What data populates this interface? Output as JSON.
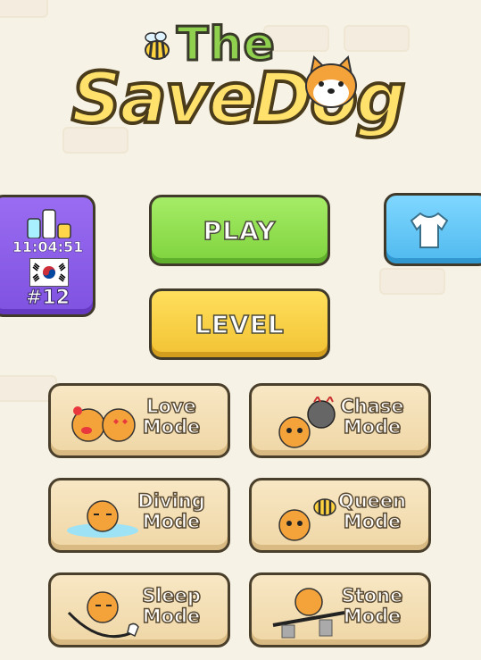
{
  "title": {
    "line1": "The",
    "line2": "SaveDog"
  },
  "buttons": {
    "play": "PLAY",
    "level": "LEVEL"
  },
  "ranking": {
    "time": "11:04:51",
    "rank": "#12",
    "flag": "south-korea-flag"
  },
  "shop": {
    "icon": "shirt-icon"
  },
  "modes": [
    {
      "line1": "Love",
      "line2": "Mode"
    },
    {
      "line1": "Chase",
      "line2": "Mode"
    },
    {
      "line1": "Diving",
      "line2": "Mode"
    },
    {
      "line1": "Queen",
      "line2": "Mode"
    },
    {
      "line1": "Sleep",
      "line2": "Mode"
    },
    {
      "line1": "Stone",
      "line2": "Mode"
    }
  ],
  "colors": {
    "play": "#8fdc4f",
    "level": "#f7cd3f",
    "ranking": "#8a5cea",
    "shop": "#5cc4f3",
    "mode": "#f3dcb0",
    "background": "#f7f2e6"
  }
}
